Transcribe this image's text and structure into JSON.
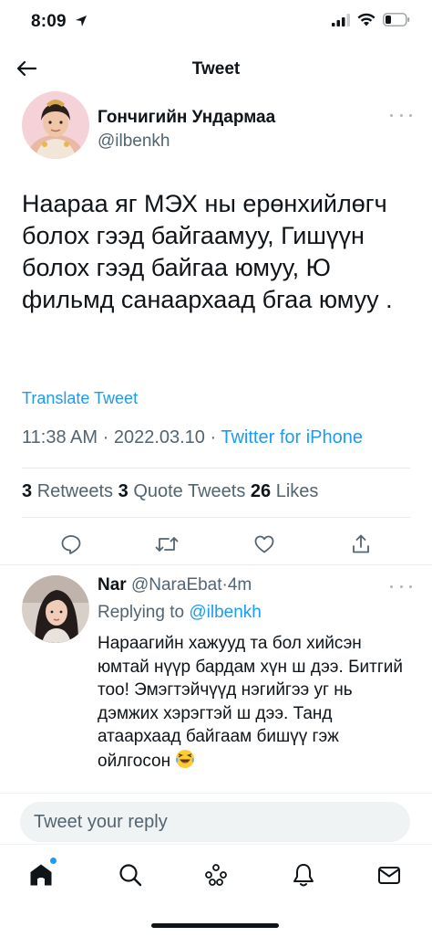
{
  "status_bar": {
    "time": "8:09",
    "icons": [
      "location-arrow-icon",
      "cellular-signal-icon",
      "wifi-icon",
      "battery-icon"
    ]
  },
  "nav": {
    "title": "Tweet",
    "back_icon": "back-arrow-icon"
  },
  "tweet": {
    "author_name": "Гончигийн Ундармаа",
    "author_handle": "@ilbenkh",
    "text": "Наараа яг МЭХ ны ерөнхийлөгч болох гээд байгаамуу, Гишүүн болох гээд байгаа юмуу, Ю фильмд санаархаад бгаа юмуу .",
    "translate_label": "Translate Tweet",
    "time": "11:38 AM",
    "date": "2022.03.10",
    "separator": "·",
    "source": "Twitter for iPhone",
    "stats": {
      "retweets_count": "3",
      "retweets_label": "Retweets",
      "quote_count": "3",
      "quote_label": "Quote Tweets",
      "likes_count": "26",
      "likes_label": "Likes"
    },
    "actions": [
      "reply-icon",
      "retweet-icon",
      "like-icon",
      "share-icon"
    ]
  },
  "reply": {
    "author_name": "Nar",
    "author_handle": "@NaraEbat",
    "separator": "·",
    "time": "4m",
    "replying_prefix": "Replying to",
    "replying_to": "@ilbenkh",
    "text": "Нараагийн хажууд та бол хийсэн юмтай нүүр бардам хүн ш дээ. Битгий тоо! Эмэгтэйчүүд нэгийгээ уг нь дэмжих хэрэгтэй ш дээ. Танд атаархаад байгаам бишүү гэж ойлгосон",
    "emoji": "laughing-emoji"
  },
  "composer": {
    "placeholder": "Tweet your reply"
  },
  "tab_bar": {
    "tabs": [
      "home-icon",
      "search-icon",
      "spaces-icon",
      "notifications-icon",
      "messages-icon"
    ]
  },
  "colors": {
    "accent": "#1d9bf0",
    "text_primary": "#0f1419",
    "text_secondary": "#536471",
    "divider": "#e7e9ea"
  }
}
